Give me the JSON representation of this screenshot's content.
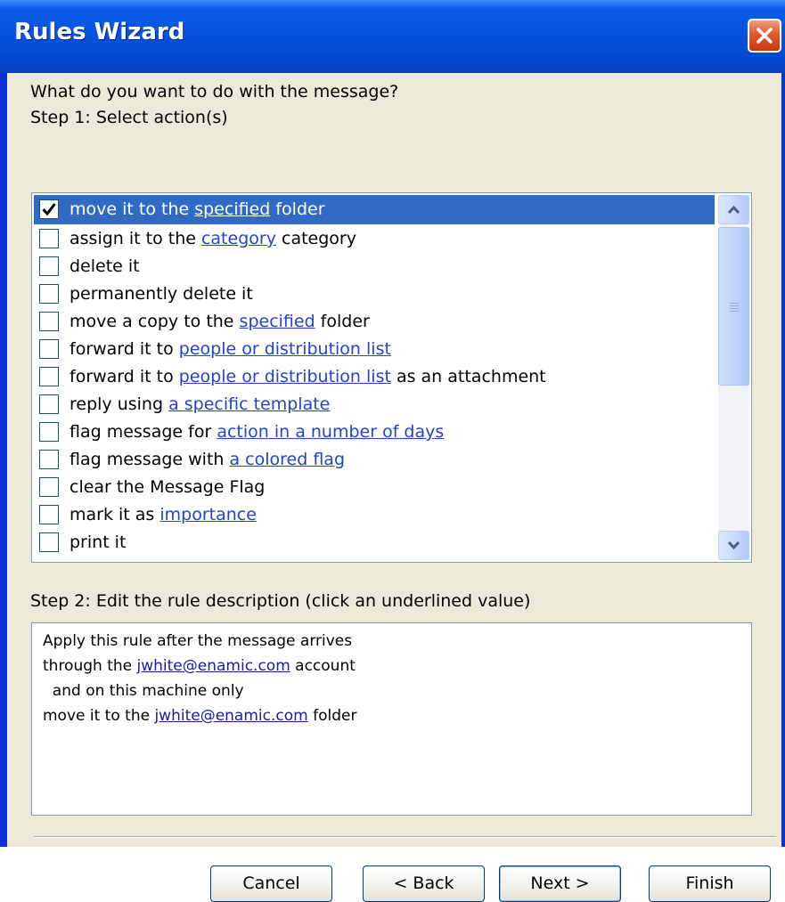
{
  "window": {
    "title": "Rules Wizard"
  },
  "step1": {
    "question": "What do you want to do with the message?",
    "heading": "Step 1: Select action(s)"
  },
  "actions": [
    {
      "pre": "move it to the ",
      "link": "specified",
      "post": " folder",
      "checked": true
    },
    {
      "pre": "assign it to the ",
      "link": "category",
      "post": " category",
      "checked": false
    },
    {
      "pre": "delete it",
      "link": "",
      "post": "",
      "checked": false
    },
    {
      "pre": "permanently delete it",
      "link": "",
      "post": "",
      "checked": false
    },
    {
      "pre": "move a copy to the ",
      "link": "specified",
      "post": " folder",
      "checked": false
    },
    {
      "pre": "forward it to ",
      "link": "people or distribution list",
      "post": "",
      "checked": false
    },
    {
      "pre": "forward it to ",
      "link": "people or distribution list",
      "post": " as an attachment",
      "checked": false
    },
    {
      "pre": "reply using ",
      "link": "a specific template",
      "post": "",
      "checked": false
    },
    {
      "pre": "flag message for ",
      "link": "action in a number of days",
      "post": "",
      "checked": false
    },
    {
      "pre": "flag message with ",
      "link": "a colored flag",
      "post": "",
      "checked": false
    },
    {
      "pre": "clear the Message Flag",
      "link": "",
      "post": "",
      "checked": false
    },
    {
      "pre": "mark it as ",
      "link": "importance",
      "post": "",
      "checked": false
    },
    {
      "pre": "print it",
      "link": "",
      "post": "",
      "checked": false
    }
  ],
  "step2": {
    "heading": "Step 2: Edit the rule description (click an underlined value)",
    "lines": [
      {
        "pre": "Apply this rule after the message arrives",
        "link": "",
        "post": ""
      },
      {
        "pre": "through the ",
        "link": "jwhite@enamic.com",
        "post": " account"
      },
      {
        "pre": "  and on this machine only",
        "link": "",
        "post": ""
      },
      {
        "pre": "move it to the ",
        "link": "jwhite@enamic.com",
        "post": " folder"
      }
    ]
  },
  "buttons": {
    "cancel": "Cancel",
    "back": "< Back",
    "next": "Next >",
    "finish": "Finish"
  },
  "colors": {
    "selection": "#316ac5",
    "link": "#2244cc",
    "dialog_bg": "#ece9d8",
    "titlebar": "#0453dd"
  }
}
